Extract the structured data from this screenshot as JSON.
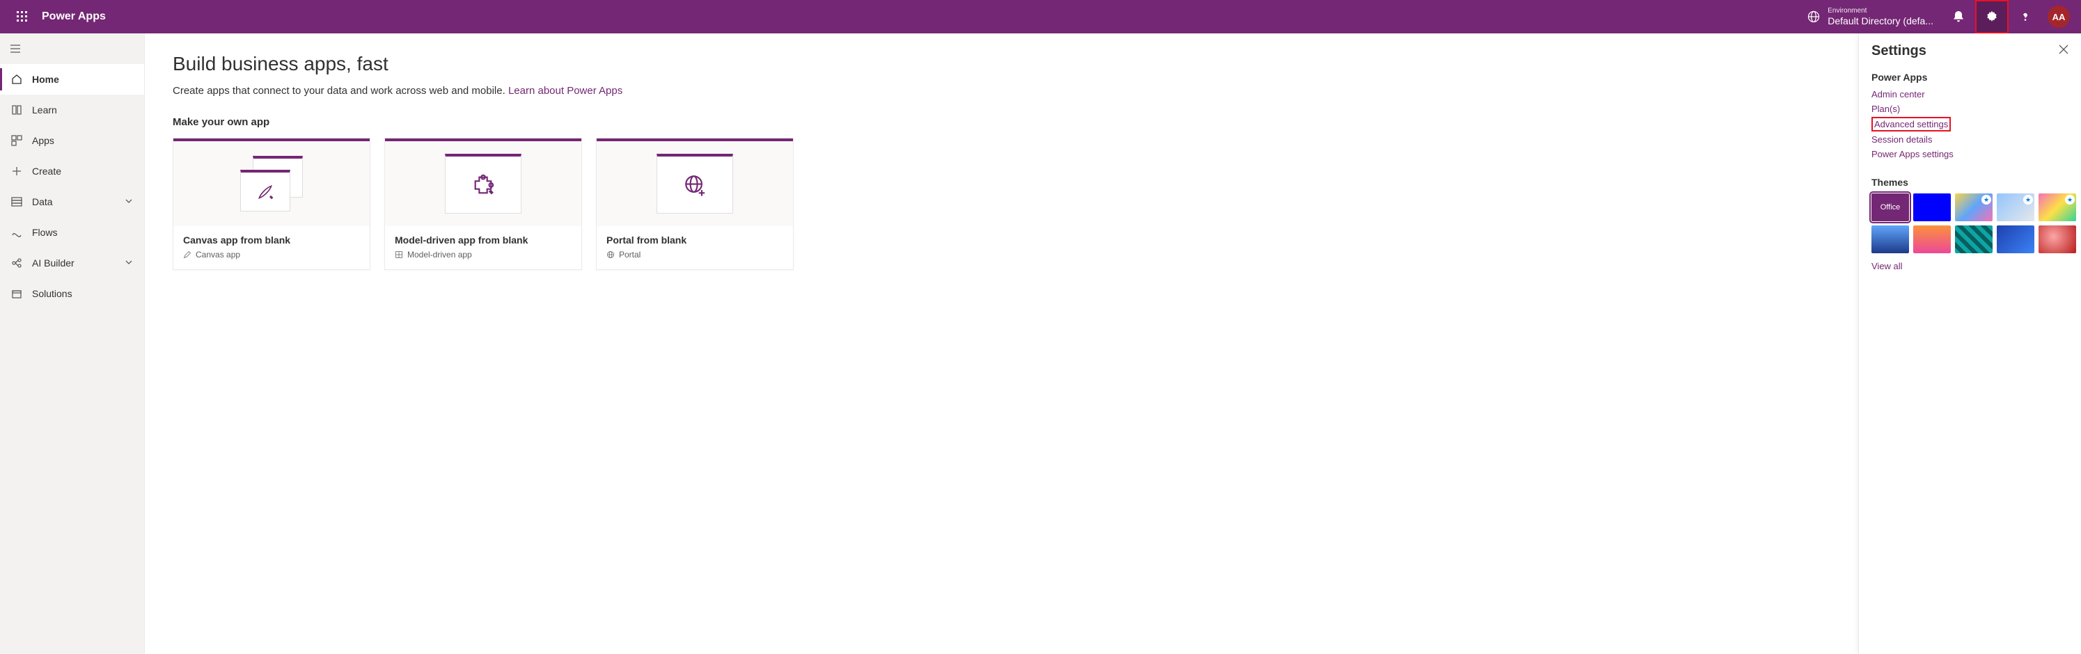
{
  "header": {
    "app_title": "Power Apps",
    "environment_label": "Environment",
    "environment_value": "Default Directory (defa...",
    "avatar_initials": "AA"
  },
  "sidebar": {
    "items": [
      {
        "label": "Home",
        "active": true
      },
      {
        "label": "Learn"
      },
      {
        "label": "Apps"
      },
      {
        "label": "Create"
      },
      {
        "label": "Data",
        "expandable": true
      },
      {
        "label": "Flows"
      },
      {
        "label": "AI Builder",
        "expandable": true
      },
      {
        "label": "Solutions"
      }
    ]
  },
  "main": {
    "page_title": "Build business apps, fast",
    "subtitle_text": "Create apps that connect to your data and work across web and mobile. ",
    "subtitle_link": "Learn about Power Apps",
    "section_title": "Make your own app",
    "cards": [
      {
        "title": "Canvas app from blank",
        "subtitle": "Canvas app"
      },
      {
        "title": "Model-driven app from blank",
        "subtitle": "Model-driven app"
      },
      {
        "title": "Portal from blank",
        "subtitle": "Portal"
      }
    ]
  },
  "settings": {
    "title": "Settings",
    "group_title": "Power Apps",
    "links": [
      "Admin center",
      "Plan(s)",
      "Advanced settings",
      "Session details",
      "Power Apps settings"
    ],
    "themes_title": "Themes",
    "office_label": "Office",
    "view_all": "View all"
  }
}
